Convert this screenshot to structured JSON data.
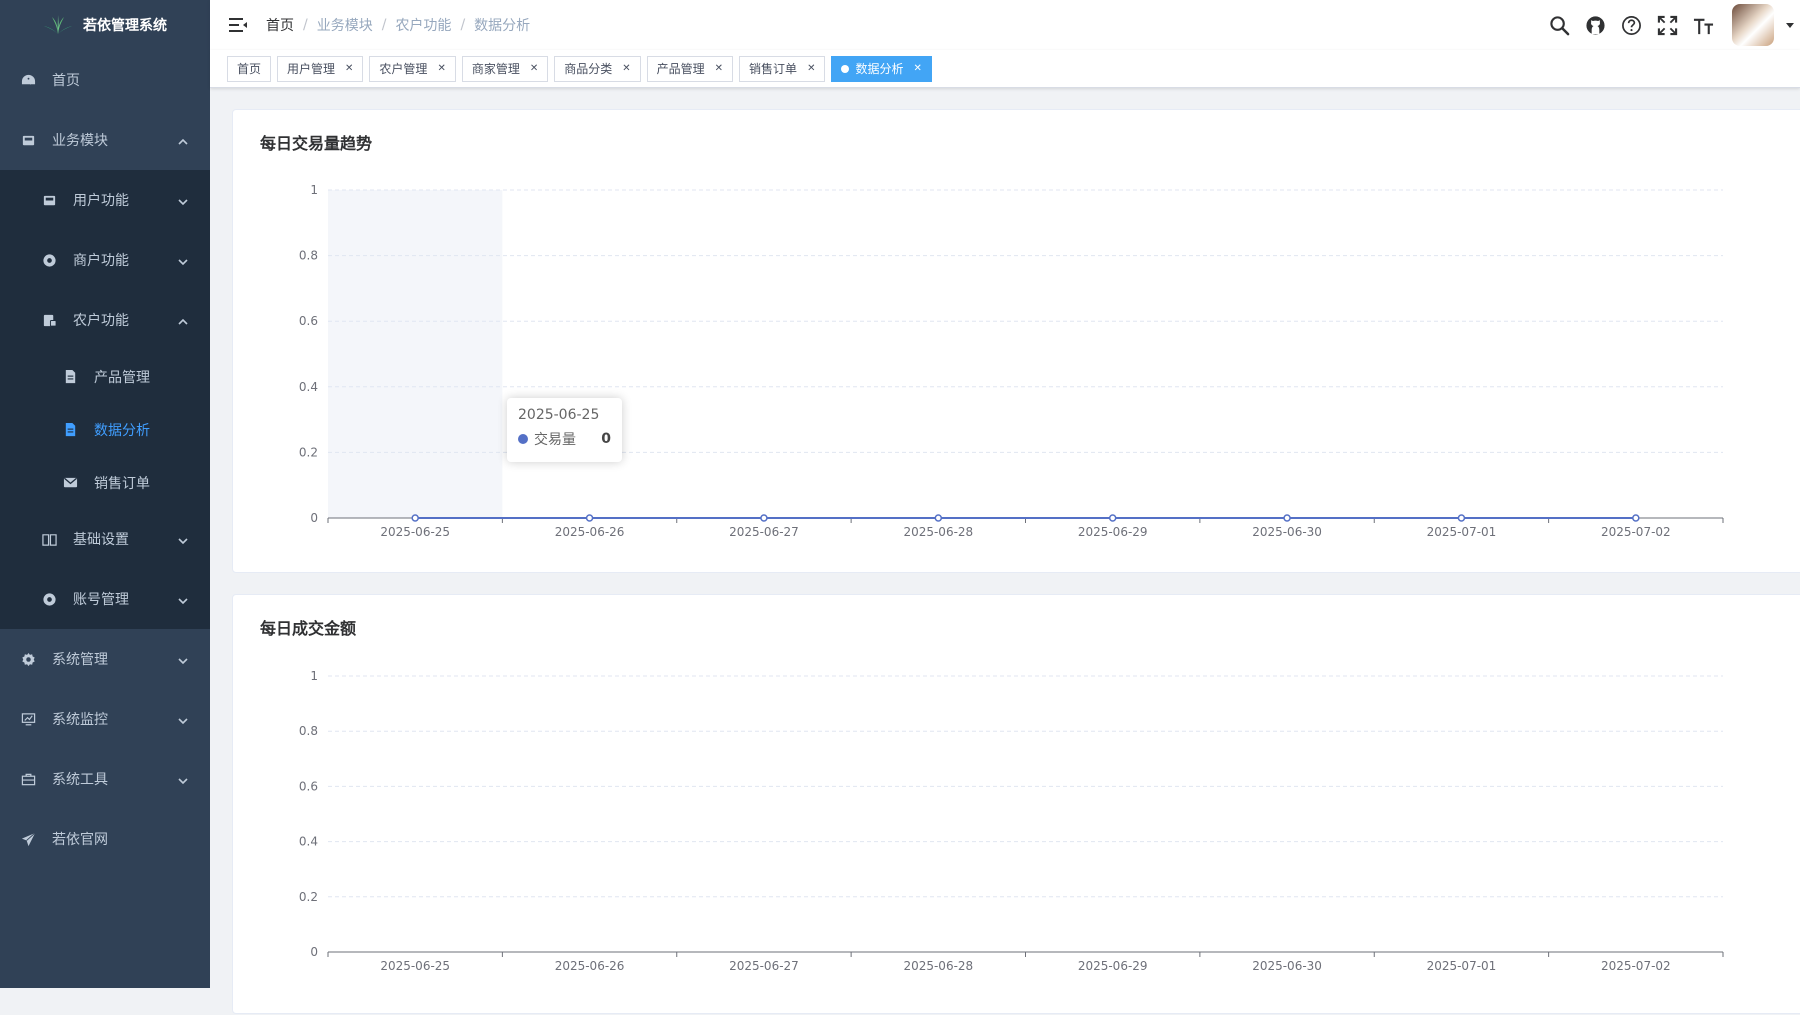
{
  "app": {
    "title": "若依管理系统"
  },
  "sidebar": {
    "items": [
      {
        "label": "首页",
        "icon": "dashboard-icon"
      },
      {
        "label": "业务模块",
        "icon": "module-icon"
      },
      {
        "label": "用户功能",
        "icon": "user-func-icon"
      },
      {
        "label": "商户功能",
        "icon": "merchant-icon"
      },
      {
        "label": "农户功能",
        "icon": "farmer-icon"
      },
      {
        "label": "产品管理",
        "icon": "document-icon"
      },
      {
        "label": "数据分析",
        "icon": "document-icon"
      },
      {
        "label": "销售订单",
        "icon": "mail-icon"
      },
      {
        "label": "基础设置",
        "icon": "book-icon"
      },
      {
        "label": "账号管理",
        "icon": "account-icon"
      },
      {
        "label": "系统管理",
        "icon": "gear-icon"
      },
      {
        "label": "系统监控",
        "icon": "monitor-icon"
      },
      {
        "label": "系统工具",
        "icon": "toolbox-icon"
      },
      {
        "label": "若依官网",
        "icon": "send-icon"
      }
    ],
    "active_label": "数据分析"
  },
  "breadcrumb": [
    "首页",
    "业务模块",
    "农户功能",
    "数据分析"
  ],
  "tags": [
    "首页",
    "用户管理",
    "农户管理",
    "商家管理",
    "商品分类",
    "产品管理",
    "销售订单",
    "数据分析"
  ],
  "active_tag": "数据分析",
  "colors": {
    "sidebar_bg": "#304156",
    "submenu_bg": "#1f2d3d",
    "accent": "#409eff",
    "tag_active": "#42a5f5",
    "series": "#5470c6"
  },
  "chart_data": [
    {
      "type": "line",
      "title": "每日交易量趋势",
      "categories": [
        "2025-06-25",
        "2025-06-26",
        "2025-06-27",
        "2025-06-28",
        "2025-06-29",
        "2025-06-30",
        "2025-07-01",
        "2025-07-02"
      ],
      "series": [
        {
          "name": "交易量",
          "values": [
            0,
            0,
            0,
            0,
            0,
            0,
            0,
            0
          ]
        }
      ],
      "y_ticks": [
        "0",
        "0.2",
        "0.4",
        "0.6",
        "0.8",
        "1"
      ],
      "ylim": [
        0,
        1
      ],
      "grid": true,
      "tooltip": {
        "category": "2025-06-25",
        "series": "交易量",
        "value": "0"
      }
    },
    {
      "type": "line",
      "title": "每日成交金额",
      "categories": [
        "2025-06-25",
        "2025-06-26",
        "2025-06-27",
        "2025-06-28",
        "2025-06-29",
        "2025-06-30",
        "2025-07-01",
        "2025-07-02"
      ],
      "series": [],
      "y_ticks": [
        "0",
        "0.2",
        "0.4",
        "0.6",
        "0.8",
        "1"
      ],
      "ylim": [
        0,
        1
      ],
      "grid": true
    }
  ]
}
